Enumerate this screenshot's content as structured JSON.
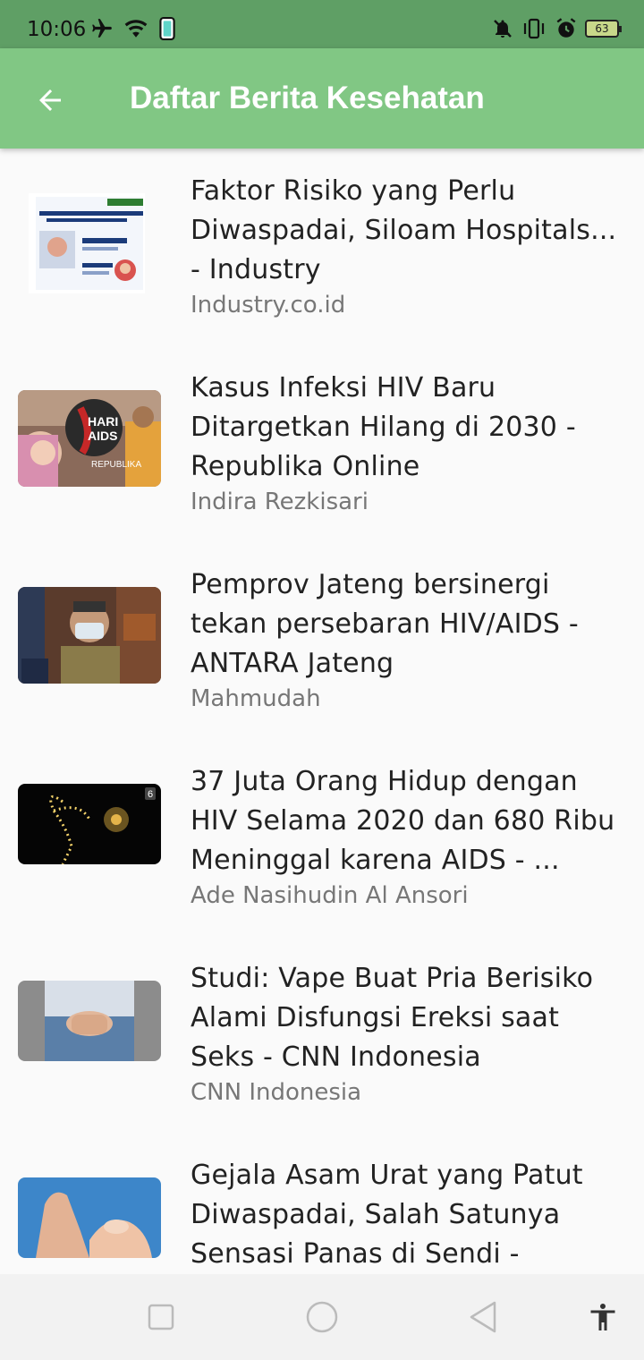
{
  "status_bar": {
    "time": "10:06",
    "battery": "63",
    "icons": [
      "airplane-icon",
      "wifi-icon",
      "phone-icon",
      "mute-icon",
      "vibrate-icon",
      "alarm-icon",
      "battery-icon"
    ]
  },
  "app_bar": {
    "title": "Daftar Berita Kesehatan",
    "back_icon": "arrow-back-icon",
    "color": "#81c784"
  },
  "news": [
    {
      "title": "Faktor Risiko yang Perlu Diwaspadai, Siloam Hospitals... - Industry",
      "source": "Industry.co.id"
    },
    {
      "title": "Kasus Infeksi HIV Baru Ditargetkan Hilang di 2030 - Republika Online",
      "source": "Indira Rezkisari"
    },
    {
      "title": "Pemprov Jateng bersinergi tekan persebaran HIV/AIDS - ANTARA Jateng",
      "source": "Mahmudah"
    },
    {
      "title": "37 Juta Orang Hidup dengan HIV Selama 2020 dan 680 Ribu Meninggal karena AIDS - ...",
      "source": "Ade Nasihudin Al Ansori"
    },
    {
      "title": "Studi: Vape Buat Pria Berisiko Alami Disfungsi Ereksi saat Seks - CNN Indonesia",
      "source": "CNN Indonesia"
    },
    {
      "title": "Gejala Asam Urat yang Patut Diwaspadai, Salah Satunya Sensasi Panas di Sendi - Tribun...",
      "source": ""
    }
  ],
  "nav_bar": {
    "icons": [
      "recent-apps-icon",
      "home-icon",
      "back-triangle-icon",
      "accessibility-icon"
    ]
  }
}
